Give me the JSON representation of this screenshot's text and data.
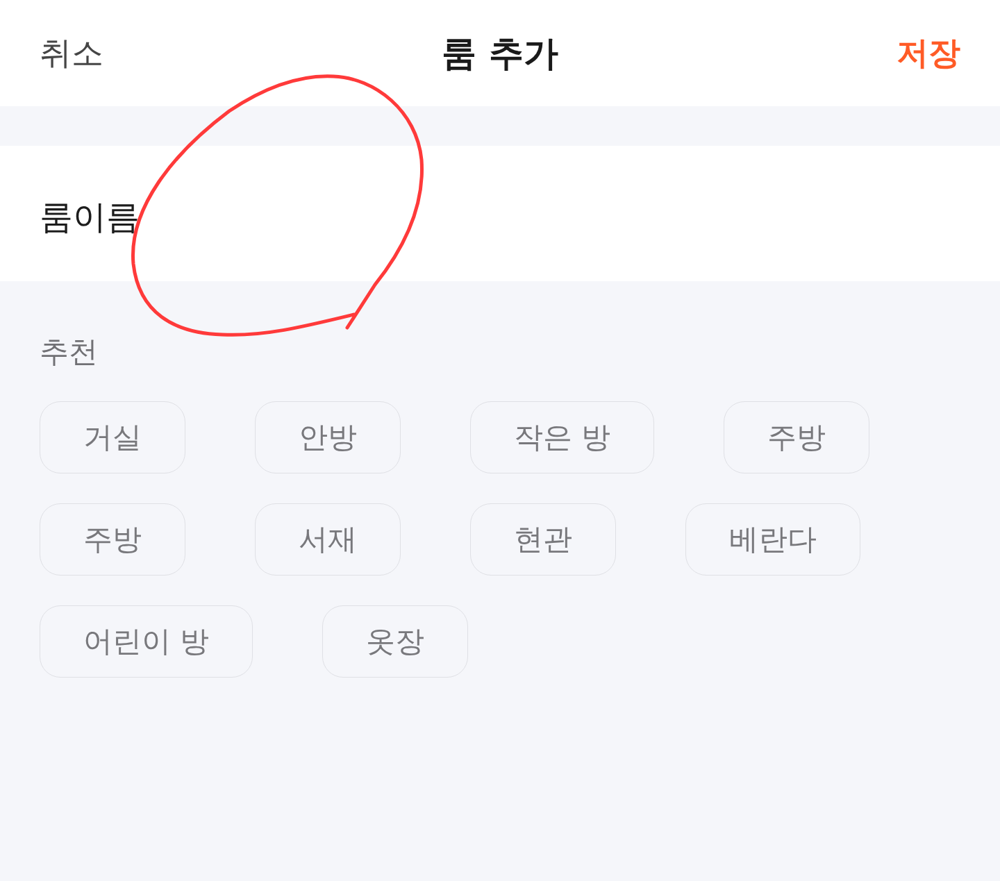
{
  "header": {
    "cancel": "취소",
    "title": "룸 추가",
    "save": "저장"
  },
  "room_name": {
    "label": "룸이름"
  },
  "suggestions": {
    "heading": "추천",
    "chips": [
      "거실",
      "안방",
      "작은 방",
      "주방",
      "주방",
      "서재",
      "현관",
      "베란다",
      "어린이 방",
      "옷장"
    ]
  },
  "annotation": {
    "kind": "loop"
  }
}
